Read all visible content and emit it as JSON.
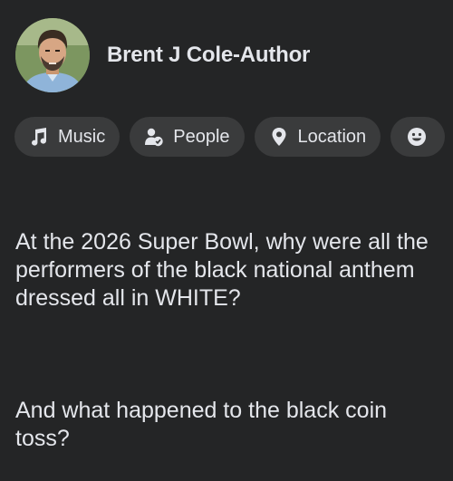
{
  "author": {
    "name": "Brent J Cole-Author"
  },
  "chips": [
    {
      "label": "Music",
      "icon": "music-note-icon"
    },
    {
      "label": "People",
      "icon": "people-icon"
    },
    {
      "label": "Location",
      "icon": "location-pin-icon"
    },
    {
      "label": "",
      "icon": "smiley-face-icon"
    }
  ],
  "post": {
    "paragraph1": "At the 2026 Super Bowl, why were all the performers of the black national anthem dressed all in WHITE?",
    "paragraph2": "And what happened to the black coin toss?"
  },
  "colors": {
    "background": "#242526",
    "chip_background": "#3a3b3c",
    "text": "#e4e6eb"
  }
}
